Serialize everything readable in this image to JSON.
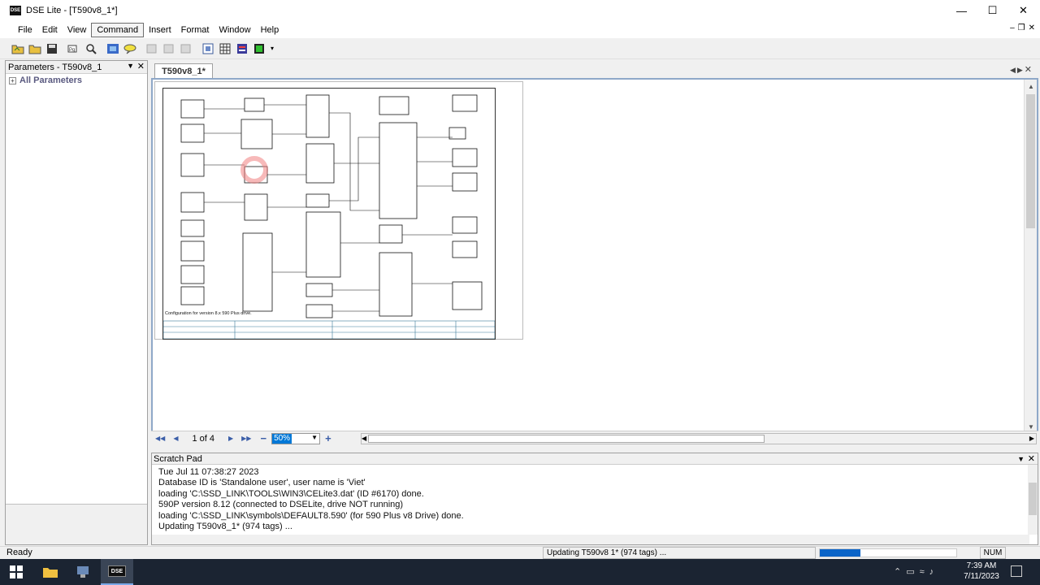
{
  "window": {
    "title": "DSE Lite - [T590v8_1*]",
    "logo_text": "DSE"
  },
  "menu": [
    "File",
    "Edit",
    "View",
    "Command",
    "Insert",
    "Format",
    "Window",
    "Help"
  ],
  "left_panel": {
    "title": "Parameters - T590v8_1",
    "tree_root": "All Parameters"
  },
  "document": {
    "tab": "T590v8_1*",
    "page_label": "1 of 4",
    "zoom": "50%",
    "footnote": "Configuration for version 8.x 590 Plus drive."
  },
  "scratch_pad": {
    "title": "Scratch Pad",
    "lines": [
      "Tue Jul 11 07:38:27 2023",
      "Database ID is 'Standalone user', user name is 'Viet'",
      "loading 'C:\\SSD_LINK\\TOOLS\\WIN3\\CELite3.dat' (ID #6170) done.",
      "590P version 8.12 (connected to DSELite, drive NOT running)",
      "loading 'C:\\SSD_LINK\\symbols\\DEFAULT8.590' (for 590 Plus v8 Drive) done.",
      "Updating T590v8_1* (974 tags) ..."
    ]
  },
  "status": {
    "ready": "Ready",
    "message": "Updating T590v8 1* (974 tags) ...",
    "progress_fraction": 0.3,
    "num": "NUM"
  },
  "taskbar": {
    "time": "7:39 AM",
    "date": "7/11/2023"
  }
}
